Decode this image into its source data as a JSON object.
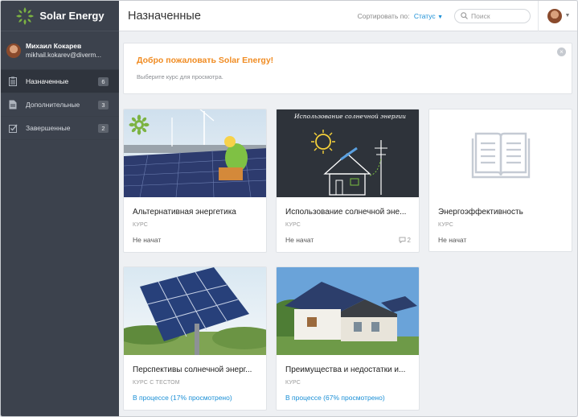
{
  "app": {
    "name": "Solar Energy"
  },
  "user": {
    "name": "Михаил Кокарев",
    "email": "mikhail.kokarev@diverm..."
  },
  "sidebar": {
    "items": [
      {
        "label": "Назначенные",
        "count": "6",
        "icon": "clipboard-icon"
      },
      {
        "label": "Дополнительные",
        "count": "3",
        "icon": "document-icon"
      },
      {
        "label": "Завершенные",
        "count": "2",
        "icon": "checkbox-icon"
      }
    ]
  },
  "header": {
    "title": "Назначенные",
    "sort_label": "Сортировать по:",
    "sort_value": "Статус",
    "search_placeholder": "Поиск"
  },
  "welcome": {
    "title": "Добро пожаловать Solar Energy!",
    "text": "Выберите курс для просмотра."
  },
  "courses": [
    {
      "title": "Альтернативная энергетика",
      "type": "КУРС",
      "status": "Не начат"
    },
    {
      "title": "Использование солнечной эне...",
      "type": "КУРС",
      "status": "Не начат",
      "comments": "2",
      "image_caption": "Использование солнечной энергии"
    },
    {
      "title": "Энергоэффективность",
      "type": "КУРС",
      "status": "Не начат"
    },
    {
      "title": "Перспективы солнечной энерг...",
      "type": "КУРС С ТЕСТОМ",
      "status": "В процессе (17% просмотрено)"
    },
    {
      "title": "Преимущества и недостатки и...",
      "type": "КУРС",
      "status": "В процессе (67% просмотрено)"
    }
  ],
  "colors": {
    "accent": "#1a8fd6",
    "welcome": "#f08c23",
    "sidebar": "#3c424d",
    "brand": "#7cb342"
  }
}
